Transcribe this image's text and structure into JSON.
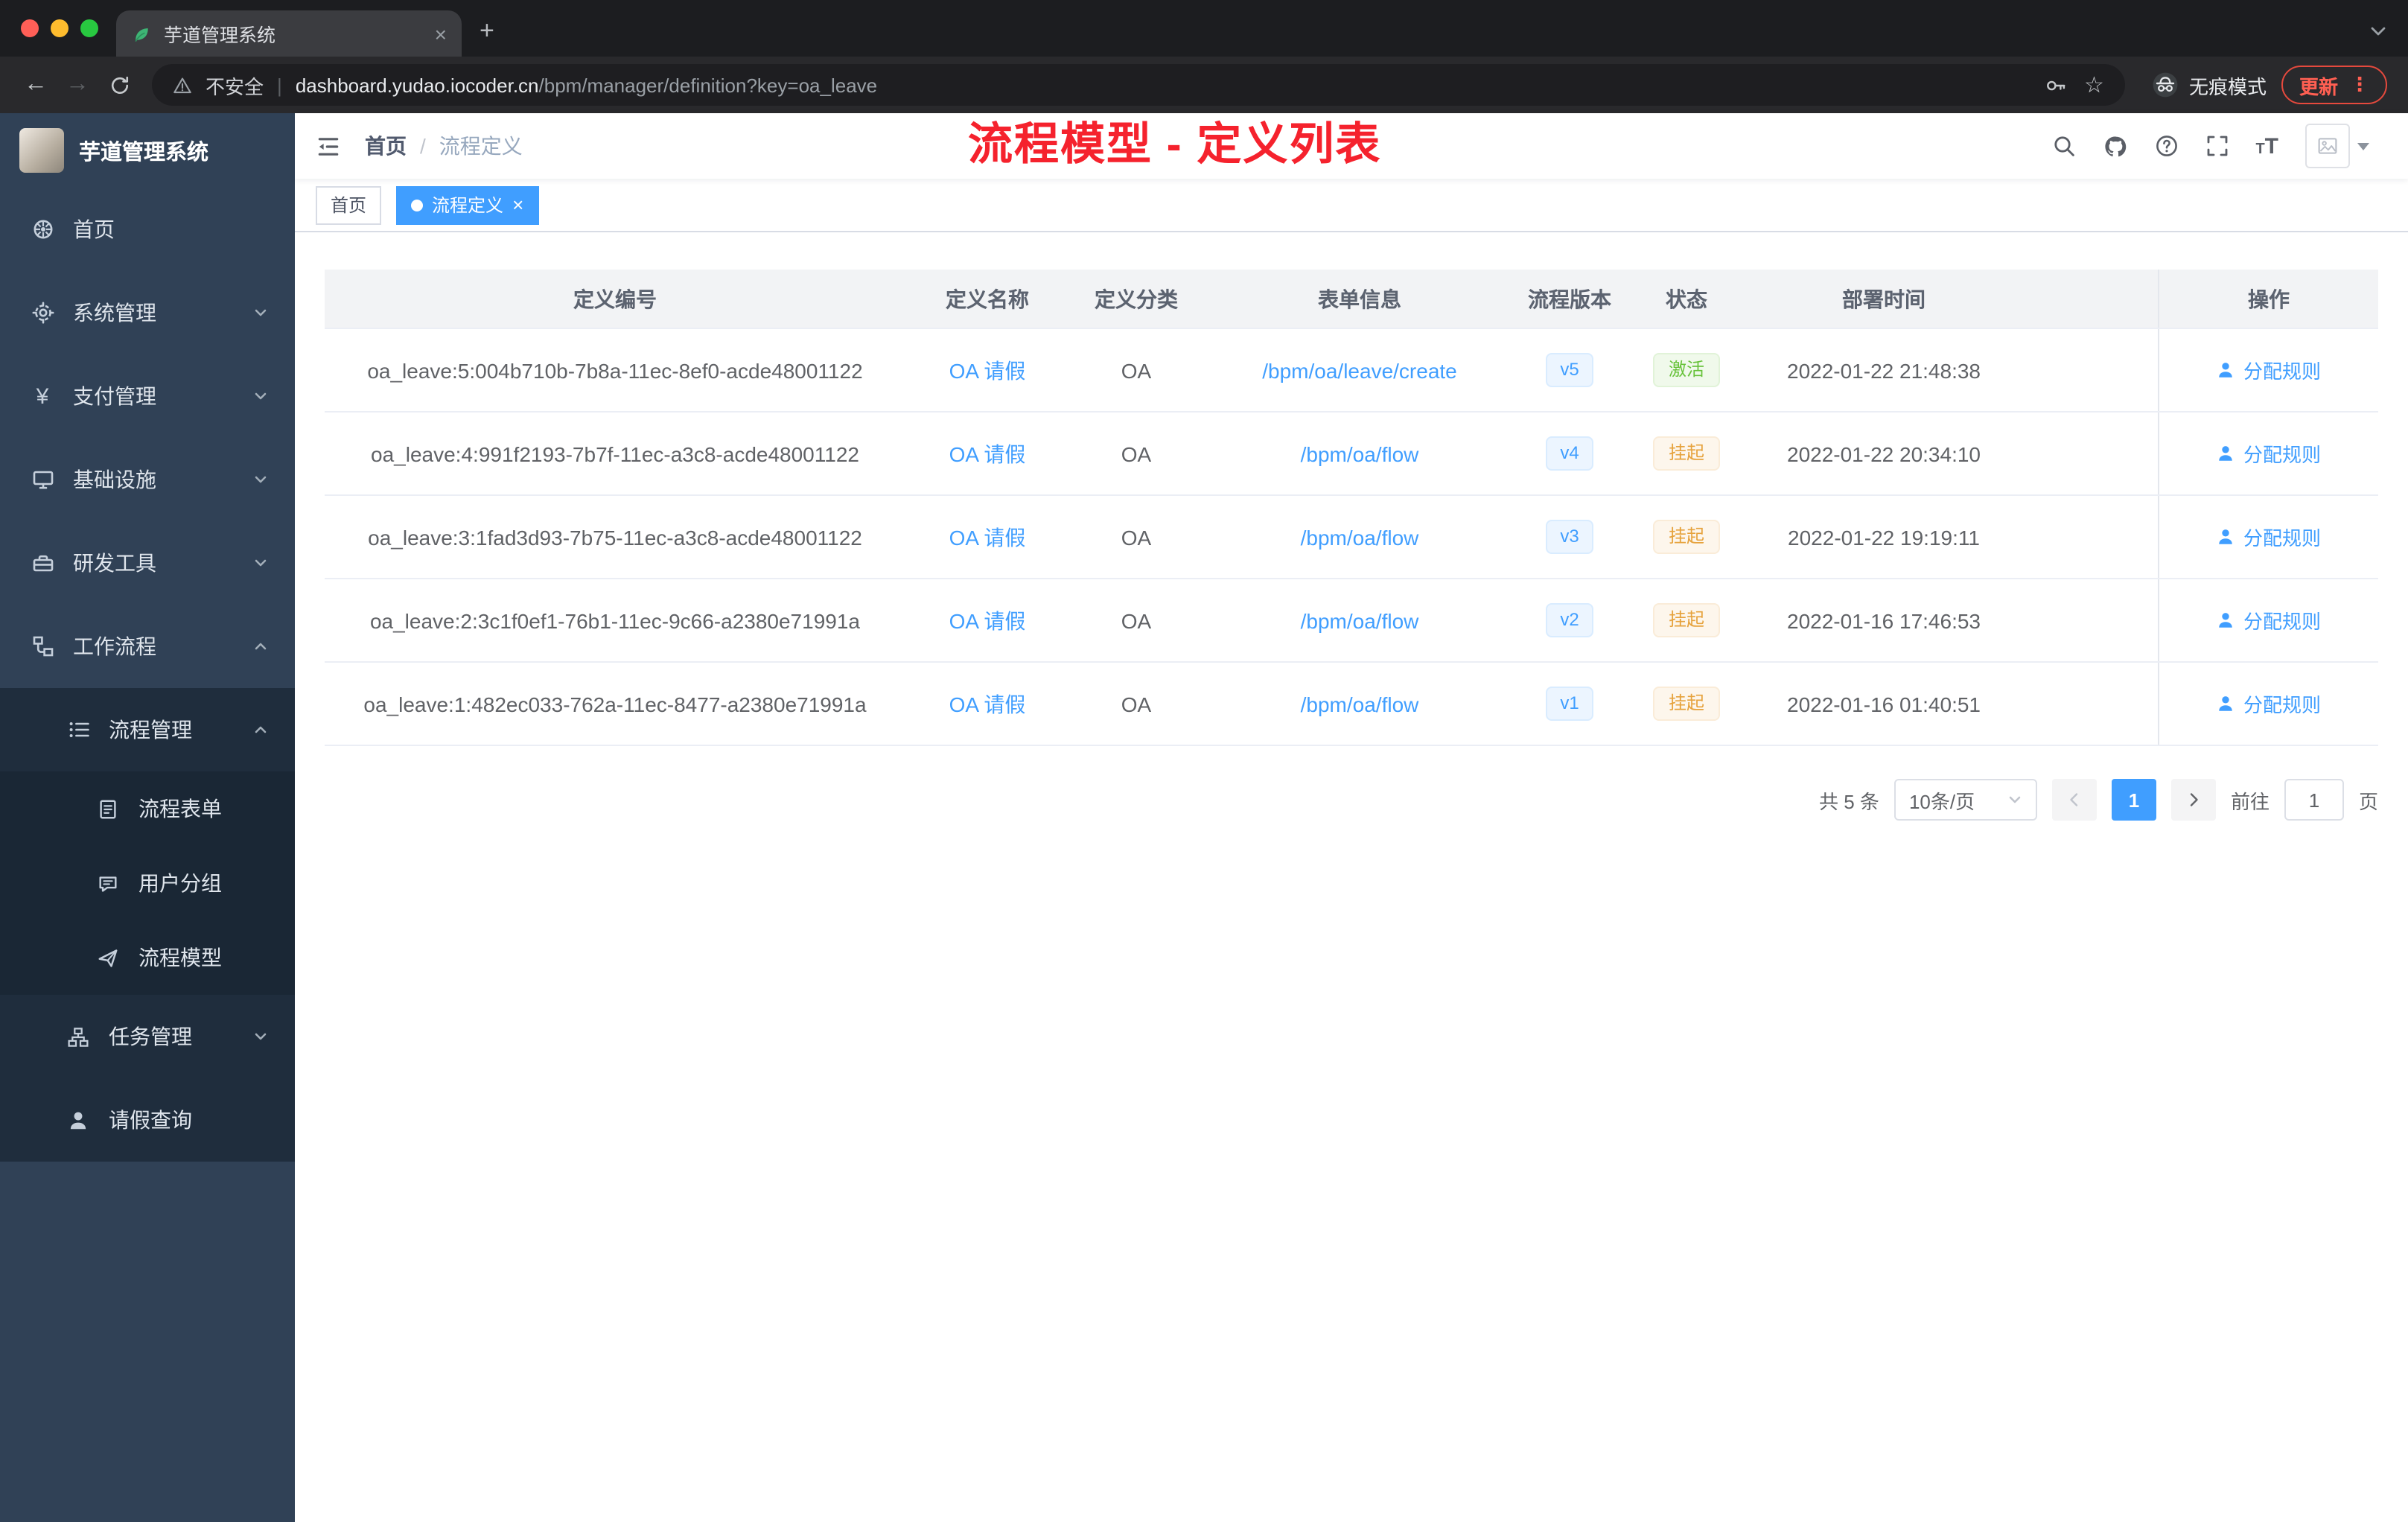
{
  "colors": {
    "primary": "#409eff",
    "success": "#67c23a",
    "warning": "#e6a23c",
    "annotation_red": "#f5222d",
    "sidebar_bg": "#304156",
    "submenu_bg": "#1f2d3d"
  },
  "browser": {
    "tab_title": "芋道管理系统",
    "security_label": "不安全",
    "url_host": "dashboard.yudao.iocoder.cn",
    "url_path": "/bpm/manager/definition?key=oa_leave",
    "incognito_label": "无痕模式",
    "update_label": "更新"
  },
  "icons": {
    "close": "×",
    "plus": "+",
    "back_arrow": "←",
    "forward_arrow": "→",
    "star": "☆",
    "more_vertical": "⋮",
    "divider": "|",
    "yen": "¥",
    "breadcrumb_separator": "/"
  },
  "sidebar": {
    "logo_title": "芋道管理系统",
    "items": [
      {
        "label": "首页",
        "icon": "dashboard-icon"
      },
      {
        "label": "系统管理",
        "icon": "system-icon"
      },
      {
        "label": "支付管理",
        "icon": "payment-icon"
      },
      {
        "label": "基础设施",
        "icon": "infrastructure-icon"
      },
      {
        "label": "研发工具",
        "icon": "devtools-icon"
      },
      {
        "label": "工作流程",
        "icon": "workflow-icon"
      },
      {
        "label": "流程管理",
        "icon": "process-management-icon"
      },
      {
        "label": "流程表单",
        "icon": "process-form-icon"
      },
      {
        "label": "用户分组",
        "icon": "user-group-icon"
      },
      {
        "label": "流程模型",
        "icon": "process-model-icon"
      },
      {
        "label": "任务管理",
        "icon": "task-management-icon"
      },
      {
        "label": "请假查询",
        "icon": "leave-query-icon"
      }
    ]
  },
  "navbar": {
    "breadcrumb_home": "首页",
    "breadcrumb_current": "流程定义",
    "annotation": "流程模型 - 定义列表"
  },
  "tags": {
    "home": "首页",
    "current": "流程定义"
  },
  "table": {
    "columns": [
      "定义编号",
      "定义名称",
      "定义分类",
      "表单信息",
      "流程版本",
      "状态",
      "部署时间",
      "操作"
    ],
    "rows": [
      {
        "id": "oa_leave:5:004b710b-7b8a-11ec-8ef0-acde48001122",
        "name": "OA 请假",
        "category": "OA",
        "form": "/bpm/oa/leave/create",
        "version": "v5",
        "status": "激活",
        "deploy_time": "2022-01-22 21:48:38",
        "action": "分配规则"
      },
      {
        "id": "oa_leave:4:991f2193-7b7f-11ec-a3c8-acde48001122",
        "name": "OA 请假",
        "category": "OA",
        "form": "/bpm/oa/flow",
        "version": "v4",
        "status": "挂起",
        "deploy_time": "2022-01-22 20:34:10",
        "action": "分配规则"
      },
      {
        "id": "oa_leave:3:1fad3d93-7b75-11ec-a3c8-acde48001122",
        "name": "OA 请假",
        "category": "OA",
        "form": "/bpm/oa/flow",
        "version": "v3",
        "status": "挂起",
        "deploy_time": "2022-01-22 19:19:11",
        "action": "分配规则"
      },
      {
        "id": "oa_leave:2:3c1f0ef1-76b1-11ec-9c66-a2380e71991a",
        "name": "OA 请假",
        "category": "OA",
        "form": "/bpm/oa/flow",
        "version": "v2",
        "status": "挂起",
        "deploy_time": "2022-01-16 17:46:53",
        "action": "分配规则"
      },
      {
        "id": "oa_leave:1:482ec033-762a-11ec-8477-a2380e71991a",
        "name": "OA 请假",
        "category": "OA",
        "form": "/bpm/oa/flow",
        "version": "v1",
        "status": "挂起",
        "deploy_time": "2022-01-16 01:40:51",
        "action": "分配规则"
      }
    ]
  },
  "pagination": {
    "total_label": "共 5 条",
    "page_size_label": "10条/页",
    "current_page": "1",
    "goto_label": "前往",
    "goto_value": "1",
    "page_unit": "页"
  }
}
